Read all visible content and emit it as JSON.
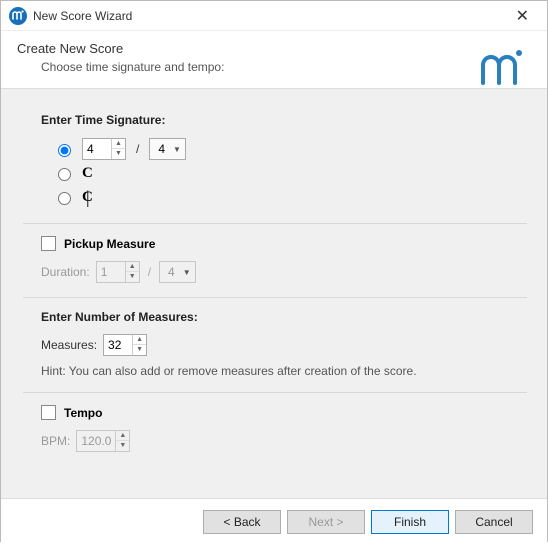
{
  "titlebar": {
    "title": "New Score Wizard"
  },
  "header": {
    "title": "Create New Score",
    "subtitle": "Choose time signature and tempo:"
  },
  "timesig": {
    "title": "Enter Time Signature:",
    "numerator": "4",
    "denominator": "4",
    "common_symbol": "C",
    "cut_symbol": "¢"
  },
  "pickup": {
    "title": "Pickup Measure",
    "duration_label": "Duration:",
    "numerator": "1",
    "denominator": "4"
  },
  "measures": {
    "title": "Enter Number of Measures:",
    "label": "Measures:",
    "value": "32",
    "hint": "Hint: You can also add or remove measures after creation of the score."
  },
  "tempo": {
    "title": "Tempo",
    "bpm_label": "BPM:",
    "value": "120.0"
  },
  "footer": {
    "back": "< Back",
    "next": "Next >",
    "finish": "Finish",
    "cancel": "Cancel"
  }
}
